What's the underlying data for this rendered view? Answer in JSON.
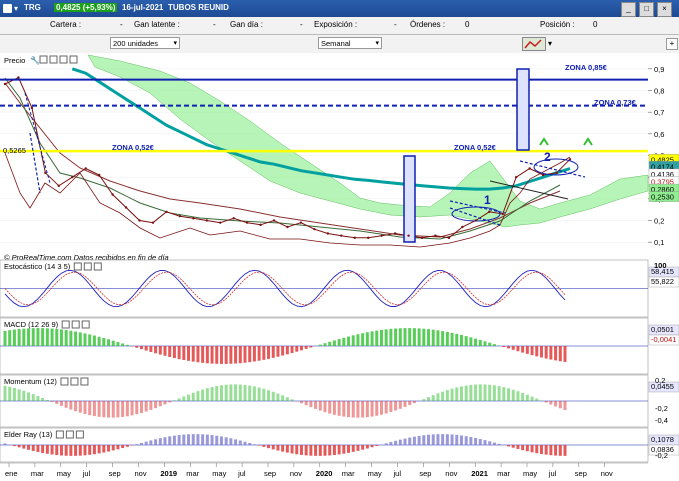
{
  "window": {
    "symbol": "TRG",
    "price": "0,4825 (+5,93%)",
    "date": "16-jul-2021",
    "name": "TUBOS REUNID"
  },
  "position_bar": {
    "cartera_label": "Cartera :",
    "cartera_value": "-",
    "gan_latente_label": "Gan latente :",
    "gan_latente_value": "-",
    "gan_dia_label": "Gan día :",
    "gan_dia_value": "-",
    "exposicion_label": "Exposición :",
    "exposicion_value": "-",
    "ordenes_label": "Órdenes :",
    "ordenes_value": "0",
    "posicion_label": "Posición :",
    "posicion_value": "0"
  },
  "controls": {
    "units": "200 unidades",
    "period": "Semanal"
  },
  "colors": {
    "price_line": "#7a1010",
    "ma_long": "#00a0a0",
    "ichimoku_fill": "#90ee90",
    "zone_blue": "#1020b0",
    "zone_yellow": "#ffff00",
    "stoch_k": "#2020c0",
    "macd_hist_pos": "#30c030",
    "macd_hist_neg": "#e03030"
  },
  "panels": {
    "price": {
      "label": "Precio",
      "footer": "© ProRealTime.com Datos recibidos en fin de día",
      "ylim": [
        0.05,
        0.95
      ],
      "yticks": [
        "0,9",
        "0,8",
        "0,7",
        "0,6",
        "0,5",
        "0,4",
        "0,3",
        "0,2",
        "0,1"
      ],
      "tick_values": [
        0.9,
        0.8,
        0.7,
        0.6,
        0.5,
        0.4,
        0.3,
        0.2,
        0.1
      ],
      "ref_level": "0,5265",
      "ref_value": 0.5265,
      "annotations": [
        "ZONA 0,85€",
        "ZONA 0,73€",
        "ZONA 0,52€",
        "ZONA 0,52€"
      ],
      "wave_labels": [
        "1",
        "2"
      ],
      "zone_levels": [
        0.85,
        0.73,
        0.52
      ],
      "badges": [
        {
          "text": "0,4825",
          "value": 0.4825,
          "bg": "#ffff00",
          "fg": "#000000"
        },
        {
          "text": "0,4174",
          "value": 0.45,
          "bg": "#30a0a0",
          "fg": "#000000"
        },
        {
          "text": "0,4136",
          "value": 0.415,
          "bg": "#ffffff",
          "fg": "#000000"
        },
        {
          "text": "0,3795",
          "value": 0.38,
          "bg": "#ffffff",
          "fg": "#c01010"
        },
        {
          "text": "0,2860",
          "value": 0.345,
          "bg": "#90ee90",
          "fg": "#000000"
        },
        {
          "text": "0,2530",
          "value": 0.31,
          "bg": "#90ee90",
          "fg": "#000000"
        }
      ]
    },
    "stochastic": {
      "label": "Estocástico (14 3 5)",
      "top_label": "100",
      "badges": [
        "58,415",
        "55,822"
      ],
      "badge_values": [
        58.415,
        55.822
      ]
    },
    "macd": {
      "label": "MACD (12 26 9)",
      "badges": [
        "0,0501",
        "-0,0041"
      ],
      "badge_values": [
        0.0501,
        -0.0041
      ]
    },
    "momentum": {
      "label": "Momentum (12)",
      "yticks": [
        "0,2",
        "-0,2",
        "-0,4"
      ],
      "tick_values": [
        0.2,
        -0.2,
        -0.4
      ],
      "badge": "0,0455",
      "badge_value": 0.0455
    },
    "elder": {
      "label": "Elder Ray (13)",
      "yticks": [
        "-0,2"
      ],
      "tick_values": [
        -0.2
      ],
      "badges": [
        "0,1078",
        "0,0836"
      ],
      "badge_values": [
        0.1078,
        0.0836
      ]
    }
  },
  "x_axis": {
    "labels": [
      "ene",
      "mar",
      "may",
      "jul",
      "sep",
      "nov",
      "2019",
      "mar",
      "may",
      "jul",
      "sep",
      "nov",
      "2020",
      "mar",
      "may",
      "jul",
      "sep",
      "nov",
      "2021",
      "mar",
      "may",
      "jul",
      "sep",
      "nov"
    ]
  },
  "chart_data": {
    "type": "line",
    "title": "",
    "xlabel": "",
    "ylabel": "",
    "ylim": [
      0.05,
      0.95
    ],
    "x": [
      "2018-01",
      "2018-02",
      "2018-03",
      "2018-04",
      "2018-05",
      "2018-06",
      "2018-07",
      "2018-08",
      "2018-09",
      "2018-10",
      "2018-11",
      "2018-12",
      "2019-01",
      "2019-02",
      "2019-03",
      "2019-04",
      "2019-05",
      "2019-06",
      "2019-07",
      "2019-08",
      "2019-09",
      "2019-10",
      "2019-11",
      "2019-12",
      "2020-01",
      "2020-02",
      "2020-03",
      "2020-04",
      "2020-05",
      "2020-06",
      "2020-07",
      "2020-08",
      "2020-09",
      "2020-10",
      "2020-11",
      "2020-12",
      "2021-01",
      "2021-02",
      "2021-03",
      "2021-04",
      "2021-05",
      "2021-06",
      "2021-07"
    ],
    "series": [
      {
        "name": "",
        "values": [
          0.83,
          0.86,
          0.72,
          0.42,
          0.36,
          0.4,
          0.44,
          0.41,
          0.32,
          0.26,
          0.2,
          0.19,
          0.24,
          0.22,
          0.21,
          0.2,
          0.19,
          0.21,
          0.19,
          0.18,
          0.2,
          0.17,
          0.19,
          0.16,
          0.14,
          0.13,
          0.12,
          0.12,
          0.13,
          0.14,
          0.13,
          0.12,
          0.13,
          0.12,
          0.17,
          0.2,
          0.24,
          0.23,
          0.4,
          0.44,
          0.41,
          0.42,
          0.4825
        ]
      },
      {
        "name": "",
        "values": [
          null,
          null,
          null,
          null,
          null,
          0.9,
          0.88,
          0.84,
          0.8,
          0.76,
          0.72,
          0.68,
          0.64,
          0.61,
          0.58,
          0.55,
          0.53,
          0.51,
          0.49,
          0.47,
          0.46,
          0.445,
          0.43,
          0.42,
          0.41,
          0.4,
          0.39,
          0.385,
          0.378,
          0.372,
          0.366,
          0.36,
          0.355,
          0.35,
          0.347,
          0.345,
          0.345,
          0.35,
          0.36,
          0.38,
          0.4,
          0.42,
          0.44
        ]
      }
    ]
  }
}
